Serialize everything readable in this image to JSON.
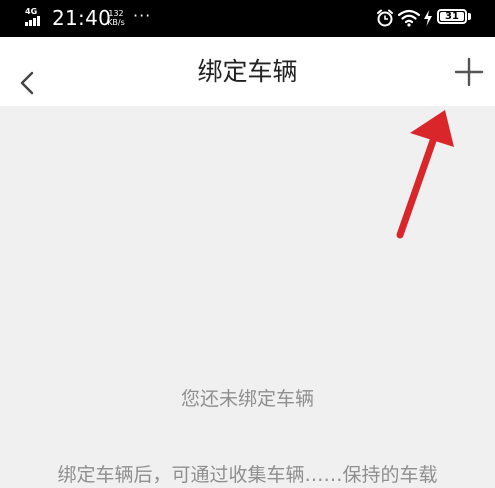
{
  "status_bar": {
    "network": "4G",
    "time": "21:40",
    "speed_value": "132",
    "speed_unit": "KB/s",
    "more_dots": "···",
    "battery_level": "31"
  },
  "nav": {
    "back_icon": "chevron-left-icon",
    "title": "绑定车辆",
    "add_icon": "plus-icon"
  },
  "content": {
    "empty_message": "您还未绑定车辆",
    "hint_partial": "绑定车辆后，可通过收集车辆……保持的车载"
  },
  "annotation": {
    "arrow_color": "#d9262b",
    "arrow_icon": "red-arrow-pointing-to-add"
  },
  "colors": {
    "status_bar_bg": "#000000",
    "nav_bg": "#ffffff",
    "page_bg": "#f0f0f0",
    "muted_text": "#8f8f8f"
  }
}
